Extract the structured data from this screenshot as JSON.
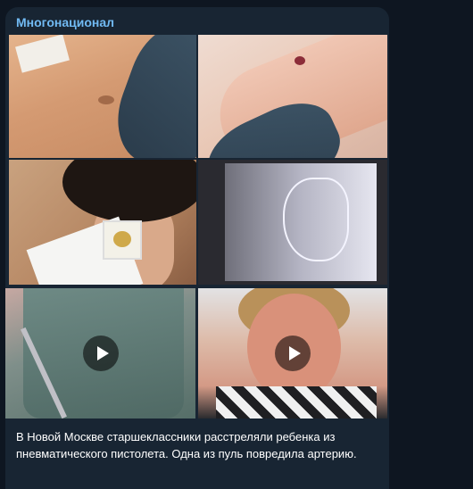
{
  "post": {
    "channel_name": "Многонационал",
    "caption": "В Новой Москве старшеклассники расстреляли ребенка из пневматического пистолета. Одна из пуль повредила артерию."
  },
  "media": [
    {
      "type": "photo",
      "icon": "photo-abdomen-wound"
    },
    {
      "type": "photo",
      "icon": "photo-arm-wound"
    },
    {
      "type": "photo",
      "icon": "photo-neck-bandage"
    },
    {
      "type": "photo",
      "icon": "photo-xray"
    },
    {
      "type": "video",
      "icon": "play-icon"
    },
    {
      "type": "video",
      "icon": "play-icon"
    }
  ],
  "colors": {
    "background": "#0e1621",
    "bubble": "#182533",
    "channel_name": "#71baf3",
    "text": "#ffffff"
  }
}
